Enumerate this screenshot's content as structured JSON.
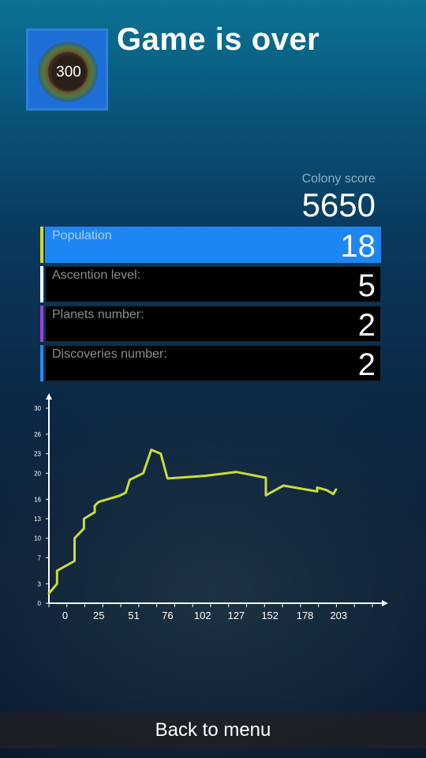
{
  "header": {
    "title": "Game is over",
    "icon_badge": "300",
    "icon": "planet-icon"
  },
  "score": {
    "label": "Colony score",
    "value": "5650"
  },
  "stats": [
    {
      "label": "Population",
      "value": "18",
      "accent": "#c8dc3c",
      "highlighted": true
    },
    {
      "label": "Ascention level:",
      "value": "5",
      "accent": "#ffffff",
      "highlighted": false
    },
    {
      "label": "Planets number:",
      "value": "2",
      "accent": "#a040d8",
      "highlighted": false
    },
    {
      "label": "Discoveries number:",
      "value": "2",
      "accent": "#2f8ae8",
      "highlighted": false
    }
  ],
  "chart_data": {
    "type": "line",
    "title": "",
    "xlabel": "",
    "ylabel": "",
    "x_ticks": [
      0,
      25,
      51,
      76,
      102,
      127,
      152,
      178,
      203
    ],
    "y_ticks": [
      0,
      3,
      7,
      10,
      13,
      16,
      20,
      23,
      26,
      30
    ],
    "xlim": [
      -12,
      228
    ],
    "ylim": [
      0,
      30
    ],
    "grid": false,
    "line_color": "#c8dc3c",
    "series": [
      {
        "x": [
          -12,
          -6,
          -6,
          7,
          7,
          14,
          14,
          22,
          22,
          25,
          40,
          45,
          48,
          58,
          64,
          71,
          76,
          77,
          104,
          127,
          149,
          149,
          162,
          187,
          187,
          194,
          199,
          201
        ],
        "y": [
          1.5,
          3,
          5,
          6.5,
          10,
          11.5,
          13,
          14,
          15,
          15.6,
          16.5,
          17,
          19,
          20,
          23.6,
          23,
          19.2,
          19.2,
          19.6,
          20.2,
          19.3,
          16.6,
          18.1,
          17.2,
          17.8,
          17.4,
          16.8,
          17.5
        ]
      }
    ]
  },
  "footer": {
    "back_label": "Back to menu"
  }
}
